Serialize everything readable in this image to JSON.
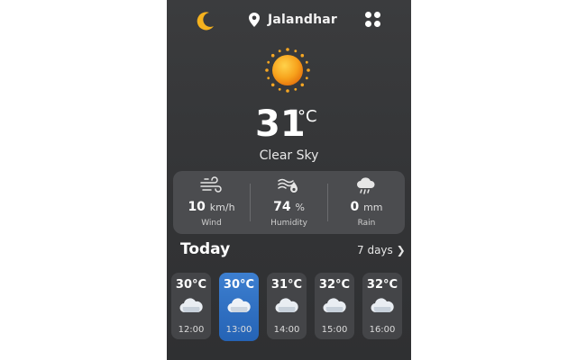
{
  "header": {
    "city": "Jalandhar",
    "moon_icon": "moon-icon",
    "pin_icon": "location-pin-icon",
    "menu_icon": "grid-menu-icon"
  },
  "current": {
    "temperature": "31",
    "unit": "°C",
    "condition": "Clear Sky",
    "icon": "sun-icon"
  },
  "stats": [
    {
      "value": "10",
      "unit": "km/h",
      "label": "Wind",
      "icon": "wind-icon"
    },
    {
      "value": "74",
      "unit": "%",
      "label": "Humidity",
      "icon": "humidity-icon"
    },
    {
      "value": "0",
      "unit": "mm",
      "label": "Rain",
      "icon": "rain-cloud-icon"
    }
  ],
  "today": {
    "title": "Today",
    "more_label": "7 days ❯"
  },
  "hourly": [
    {
      "temp": "30°C",
      "time": "12:00",
      "active": false
    },
    {
      "temp": "30°C",
      "time": "13:00",
      "active": true
    },
    {
      "temp": "31°C",
      "time": "14:00",
      "active": false
    },
    {
      "temp": "32°C",
      "time": "15:00",
      "active": false
    },
    {
      "temp": "32°C",
      "time": "16:00",
      "active": false
    }
  ],
  "colors": {
    "background": "#333436",
    "card": "#4b4c4f",
    "accent": "#2f6fc2",
    "sun": "#f5a623"
  }
}
